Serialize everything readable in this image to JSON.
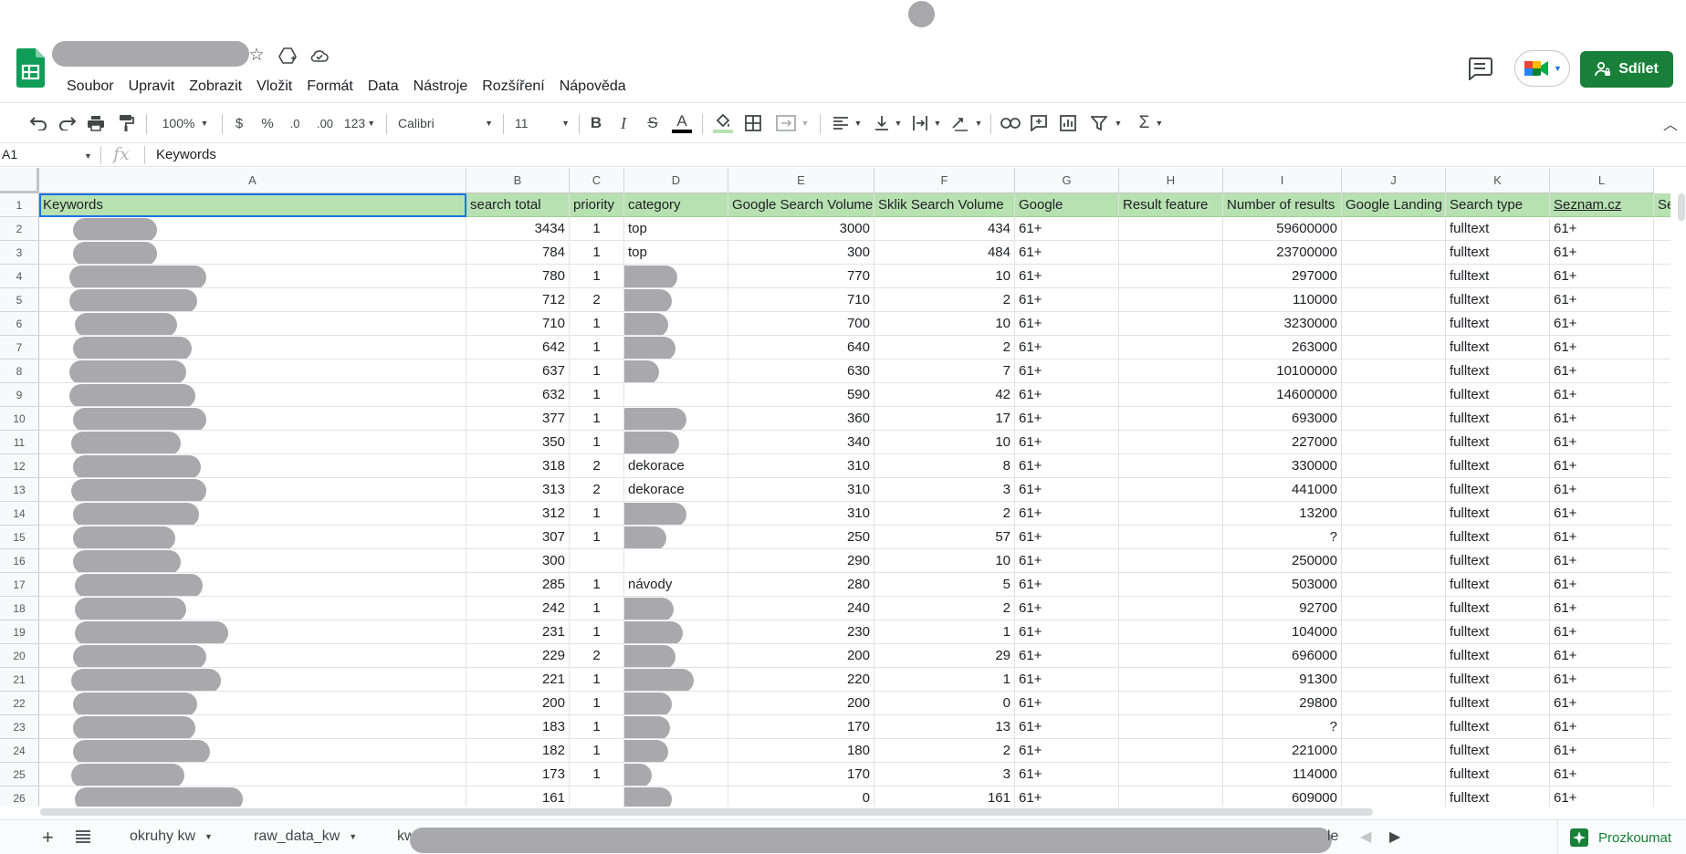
{
  "app": {
    "menu": [
      "Soubor",
      "Upravit",
      "Zobrazit",
      "Vložit",
      "Formát",
      "Data",
      "Nástroje",
      "Rozšíření",
      "Nápověda"
    ],
    "share_label": "Sdílet"
  },
  "toolbar": {
    "zoom": "100%",
    "currency": "$",
    "percent": "%",
    "dec_decrease": ".0",
    "dec_increase": ".00",
    "number_format": "123",
    "font": "Calibri",
    "font_size": "11",
    "bold": "B",
    "italic": "I",
    "strike": "S",
    "text_color": "A",
    "sum": "Σ"
  },
  "formula_bar": {
    "cell_ref": "A1",
    "fx": "fx",
    "value": "Keywords"
  },
  "sheet": {
    "columns": [
      "A",
      "B",
      "C",
      "D",
      "E",
      "F",
      "G",
      "H",
      "I",
      "J",
      "K",
      "L"
    ],
    "header": [
      "Keywords",
      "search total",
      "priority",
      "category",
      "Google Search Volume",
      "Sklik Search Volume",
      "Google",
      "Result feature",
      "Number of results",
      "Google Landing I",
      "Search type",
      "Seznam.cz",
      "Se"
    ],
    "rows": [
      {
        "n": "2",
        "b": "3434",
        "c": "1",
        "d": "top",
        "e": "3000",
        "f": "434",
        "g": "61+",
        "i": "59600000",
        "k": "fulltext",
        "l": "61+"
      },
      {
        "n": "3",
        "b": "784",
        "c": "1",
        "d": "top",
        "e": "300",
        "f": "484",
        "g": "61+",
        "i": "23700000",
        "k": "fulltext",
        "l": "61+"
      },
      {
        "n": "4",
        "b": "780",
        "c": "1",
        "d": "",
        "e": "770",
        "f": "10",
        "g": "61+",
        "i": "297000",
        "k": "fulltext",
        "l": "61+"
      },
      {
        "n": "5",
        "b": "712",
        "c": "2",
        "d": "",
        "e": "710",
        "f": "2",
        "g": "61+",
        "i": "110000",
        "k": "fulltext",
        "l": "61+"
      },
      {
        "n": "6",
        "b": "710",
        "c": "1",
        "d": "",
        "e": "700",
        "f": "10",
        "g": "61+",
        "i": "3230000",
        "k": "fulltext",
        "l": "61+"
      },
      {
        "n": "7",
        "b": "642",
        "c": "1",
        "d": "",
        "e": "640",
        "f": "2",
        "g": "61+",
        "i": "263000",
        "k": "fulltext",
        "l": "61+"
      },
      {
        "n": "8",
        "b": "637",
        "c": "1",
        "d": "",
        "e": "630",
        "f": "7",
        "g": "61+",
        "i": "10100000",
        "k": "fulltext",
        "l": "61+"
      },
      {
        "n": "9",
        "b": "632",
        "c": "1",
        "d": "",
        "e": "590",
        "f": "42",
        "g": "61+",
        "i": "14600000",
        "k": "fulltext",
        "l": "61+"
      },
      {
        "n": "10",
        "b": "377",
        "c": "1",
        "d": "",
        "e": "360",
        "f": "17",
        "g": "61+",
        "i": "693000",
        "k": "fulltext",
        "l": "61+"
      },
      {
        "n": "11",
        "b": "350",
        "c": "1",
        "d": "",
        "e": "340",
        "f": "10",
        "g": "61+",
        "i": "227000",
        "k": "fulltext",
        "l": "61+"
      },
      {
        "n": "12",
        "b": "318",
        "c": "2",
        "d": "dekorace",
        "e": "310",
        "f": "8",
        "g": "61+",
        "i": "330000",
        "k": "fulltext",
        "l": "61+"
      },
      {
        "n": "13",
        "b": "313",
        "c": "2",
        "d": "dekorace",
        "e": "310",
        "f": "3",
        "g": "61+",
        "i": "441000",
        "k": "fulltext",
        "l": "61+"
      },
      {
        "n": "14",
        "b": "312",
        "c": "1",
        "d": "",
        "e": "310",
        "f": "2",
        "g": "61+",
        "i": "13200",
        "k": "fulltext",
        "l": "61+"
      },
      {
        "n": "15",
        "b": "307",
        "c": "1",
        "d": "",
        "e": "250",
        "f": "57",
        "g": "61+",
        "i": "?",
        "k": "fulltext",
        "l": "61+"
      },
      {
        "n": "16",
        "b": "300",
        "c": "",
        "d": "",
        "e": "290",
        "f": "10",
        "g": "61+",
        "i": "250000",
        "k": "fulltext",
        "l": "61+"
      },
      {
        "n": "17",
        "b": "285",
        "c": "1",
        "d": "návody",
        "e": "280",
        "f": "5",
        "g": "61+",
        "i": "503000",
        "k": "fulltext",
        "l": "61+"
      },
      {
        "n": "18",
        "b": "242",
        "c": "1",
        "d": "",
        "e": "240",
        "f": "2",
        "g": "61+",
        "i": "92700",
        "k": "fulltext",
        "l": "61+"
      },
      {
        "n": "19",
        "b": "231",
        "c": "1",
        "d": "",
        "e": "230",
        "f": "1",
        "g": "61+",
        "i": "104000",
        "k": "fulltext",
        "l": "61+"
      },
      {
        "n": "20",
        "b": "229",
        "c": "2",
        "d": "",
        "e": "200",
        "f": "29",
        "g": "61+",
        "i": "696000",
        "k": "fulltext",
        "l": "61+"
      },
      {
        "n": "21",
        "b": "221",
        "c": "1",
        "d": "",
        "e": "220",
        "f": "1",
        "g": "61+",
        "i": "91300",
        "k": "fulltext",
        "l": "61+"
      },
      {
        "n": "22",
        "b": "200",
        "c": "1",
        "d": "",
        "e": "200",
        "f": "0",
        "g": "61+",
        "i": "29800",
        "k": "fulltext",
        "l": "61+"
      },
      {
        "n": "23",
        "b": "183",
        "c": "1",
        "d": "",
        "e": "170",
        "f": "13",
        "g": "61+",
        "i": "?",
        "k": "fulltext",
        "l": "61+"
      },
      {
        "n": "24",
        "b": "182",
        "c": "1",
        "d": "",
        "e": "180",
        "f": "2",
        "g": "61+",
        "i": "221000",
        "k": "fulltext",
        "l": "61+"
      },
      {
        "n": "25",
        "b": "173",
        "c": "1",
        "d": "",
        "e": "170",
        "f": "3",
        "g": "61+",
        "i": "114000",
        "k": "fulltext",
        "l": "61+"
      },
      {
        "n": "26",
        "b": "161",
        "c": "",
        "d": "",
        "e": "0",
        "f": "161",
        "g": "61+",
        "i": "609000",
        "k": "fulltext",
        "l": "61+"
      }
    ]
  },
  "tabs": {
    "items": [
      "okruhy kw",
      "raw_data_kw",
      "kw"
    ],
    "trailing": "le",
    "explore_label": "Prozkoumat"
  },
  "colors": {
    "header_fill": "#b7e1b1",
    "accent_green": "#188038",
    "selection_blue": "#1a73e8"
  }
}
